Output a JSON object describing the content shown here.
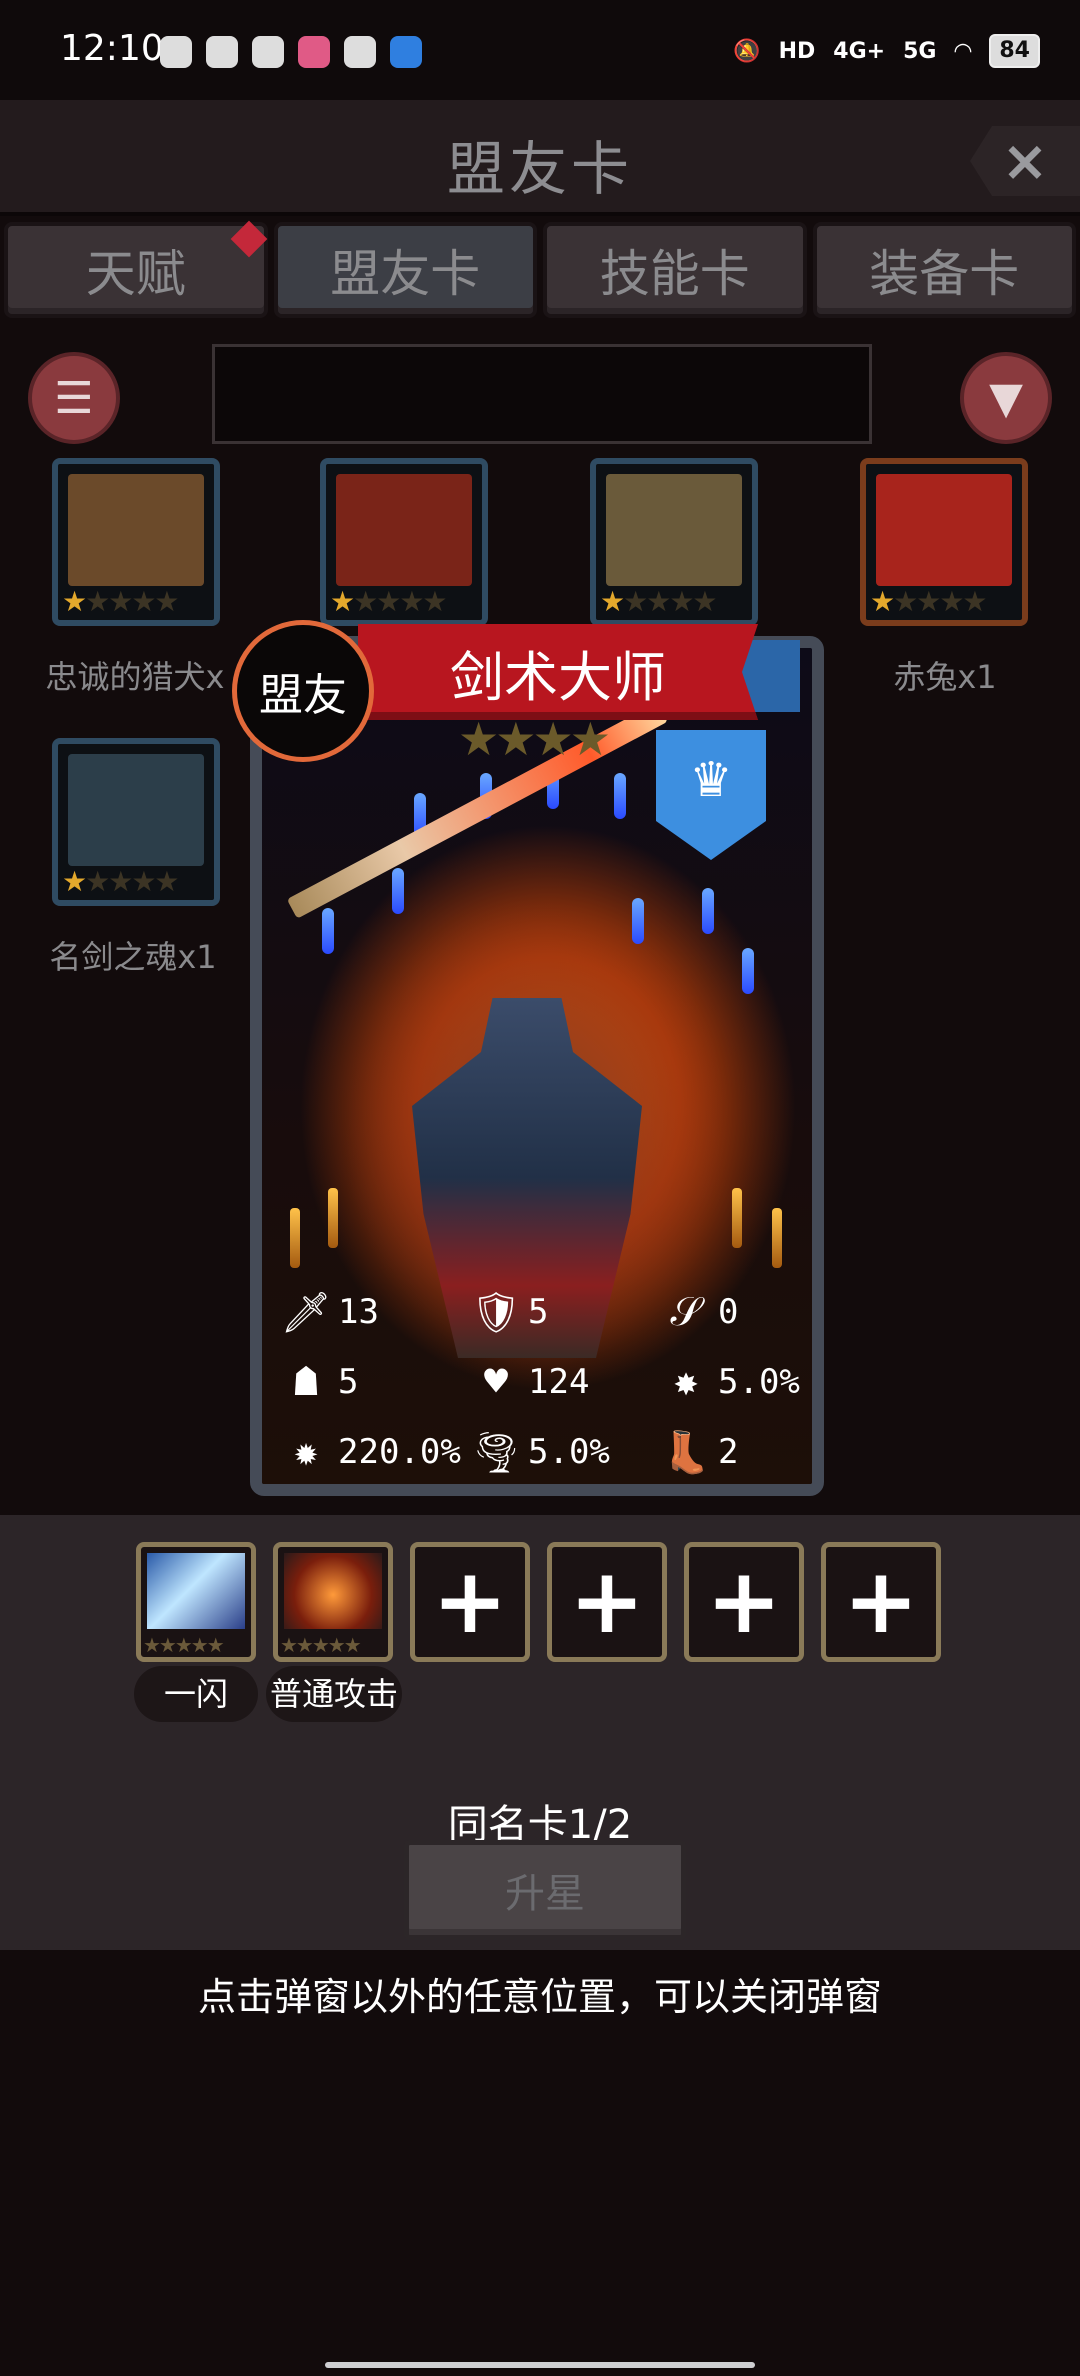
{
  "status_bar": {
    "time": "12:10",
    "network": "5G",
    "network2": "4G+",
    "hd": "HD",
    "battery": "84"
  },
  "header": {
    "title": "盟友卡",
    "close": "×"
  },
  "tabs": [
    {
      "label": "天赋",
      "has_dot": true
    },
    {
      "label": "盟友卡",
      "active": true
    },
    {
      "label": "技能卡"
    },
    {
      "label": "装备卡"
    }
  ],
  "search": {
    "value": ""
  },
  "card_grid": [
    {
      "label": "忠诚的猎犬x",
      "stars_filled": 1,
      "stars_total": 5,
      "border": "blue",
      "art_color": "#6b4a2a"
    },
    {
      "label": "",
      "stars_filled": 1,
      "stars_total": 5,
      "border": "blue",
      "art_color": "#7a2418"
    },
    {
      "label": "",
      "stars_filled": 1,
      "stars_total": 5,
      "border": "blue",
      "art_color": "#6a5a3a"
    },
    {
      "label": "赤兔x1",
      "stars_filled": 1,
      "stars_total": 5,
      "border": "gold",
      "art_color": "#a8241c"
    },
    {
      "label": "名剑之魂x1",
      "stars_filled": 1,
      "stars_total": 5,
      "border": "blue",
      "art_color": "#2c3e4a"
    }
  ],
  "popup": {
    "ally_tag": "盟友",
    "name": "剑术大师",
    "stars_total": 4,
    "class_icon": "crown-icon",
    "stats": [
      {
        "icon": "sword-icon",
        "glyph": "🗡",
        "value": "13"
      },
      {
        "icon": "shield-icon",
        "glyph": "🛡",
        "value": "5"
      },
      {
        "icon": "boot-kick-icon",
        "glyph": "𝒮",
        "value": "0"
      },
      {
        "icon": "hood-icon",
        "glyph": "☗",
        "value": "5"
      },
      {
        "icon": "heart-icon",
        "glyph": "♥",
        "value": "124"
      },
      {
        "icon": "burst-icon",
        "glyph": "✸",
        "value": "5.0%"
      },
      {
        "icon": "crit-damage-icon",
        "glyph": "✹",
        "value": "220.0%"
      },
      {
        "icon": "tornado-icon",
        "glyph": "🌪",
        "value": "5.0%"
      },
      {
        "icon": "speed-boot-icon",
        "glyph": "👢",
        "value": "2"
      }
    ]
  },
  "skills": [
    {
      "label": "一闪",
      "art": "lightning"
    },
    {
      "label": "普通攻击",
      "art": "axe"
    },
    {
      "plus": "+"
    },
    {
      "plus": "+"
    },
    {
      "plus": "+"
    },
    {
      "plus": "+"
    }
  ],
  "dup_cards": "同名卡1/2",
  "upgrade_label": "升星",
  "hint": "点击弹窗以外的任意位置，可以关闭弹窗",
  "colors": {
    "accent_red": "#b8161f",
    "badge_blue": "#3d8fe0",
    "star_gold": "#e3a82c"
  }
}
